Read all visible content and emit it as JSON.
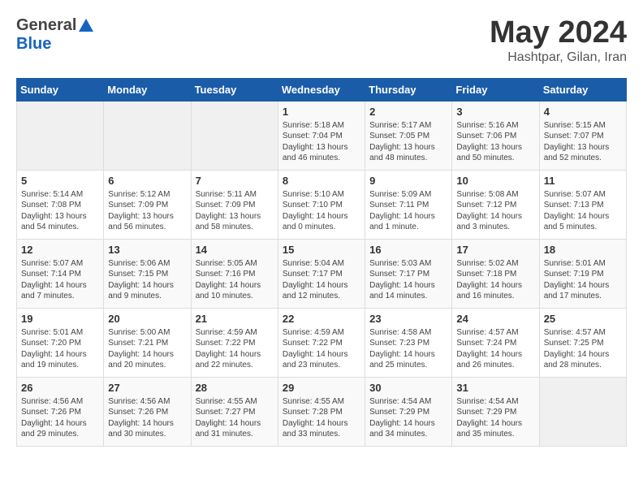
{
  "header": {
    "logo_general": "General",
    "logo_blue": "Blue",
    "month_title": "May 2024",
    "subtitle": "Hashtpar, Gilan, Iran"
  },
  "weekdays": [
    "Sunday",
    "Monday",
    "Tuesday",
    "Wednesday",
    "Thursday",
    "Friday",
    "Saturday"
  ],
  "weeks": [
    [
      {
        "day": "",
        "sunrise": "",
        "sunset": "",
        "daylight": ""
      },
      {
        "day": "",
        "sunrise": "",
        "sunset": "",
        "daylight": ""
      },
      {
        "day": "",
        "sunrise": "",
        "sunset": "",
        "daylight": ""
      },
      {
        "day": "1",
        "sunrise": "Sunrise: 5:18 AM",
        "sunset": "Sunset: 7:04 PM",
        "daylight": "Daylight: 13 hours and 46 minutes."
      },
      {
        "day": "2",
        "sunrise": "Sunrise: 5:17 AM",
        "sunset": "Sunset: 7:05 PM",
        "daylight": "Daylight: 13 hours and 48 minutes."
      },
      {
        "day": "3",
        "sunrise": "Sunrise: 5:16 AM",
        "sunset": "Sunset: 7:06 PM",
        "daylight": "Daylight: 13 hours and 50 minutes."
      },
      {
        "day": "4",
        "sunrise": "Sunrise: 5:15 AM",
        "sunset": "Sunset: 7:07 PM",
        "daylight": "Daylight: 13 hours and 52 minutes."
      }
    ],
    [
      {
        "day": "5",
        "sunrise": "Sunrise: 5:14 AM",
        "sunset": "Sunset: 7:08 PM",
        "daylight": "Daylight: 13 hours and 54 minutes."
      },
      {
        "day": "6",
        "sunrise": "Sunrise: 5:12 AM",
        "sunset": "Sunset: 7:09 PM",
        "daylight": "Daylight: 13 hours and 56 minutes."
      },
      {
        "day": "7",
        "sunrise": "Sunrise: 5:11 AM",
        "sunset": "Sunset: 7:09 PM",
        "daylight": "Daylight: 13 hours and 58 minutes."
      },
      {
        "day": "8",
        "sunrise": "Sunrise: 5:10 AM",
        "sunset": "Sunset: 7:10 PM",
        "daylight": "Daylight: 14 hours and 0 minutes."
      },
      {
        "day": "9",
        "sunrise": "Sunrise: 5:09 AM",
        "sunset": "Sunset: 7:11 PM",
        "daylight": "Daylight: 14 hours and 1 minute."
      },
      {
        "day": "10",
        "sunrise": "Sunrise: 5:08 AM",
        "sunset": "Sunset: 7:12 PM",
        "daylight": "Daylight: 14 hours and 3 minutes."
      },
      {
        "day": "11",
        "sunrise": "Sunrise: 5:07 AM",
        "sunset": "Sunset: 7:13 PM",
        "daylight": "Daylight: 14 hours and 5 minutes."
      }
    ],
    [
      {
        "day": "12",
        "sunrise": "Sunrise: 5:07 AM",
        "sunset": "Sunset: 7:14 PM",
        "daylight": "Daylight: 14 hours and 7 minutes."
      },
      {
        "day": "13",
        "sunrise": "Sunrise: 5:06 AM",
        "sunset": "Sunset: 7:15 PM",
        "daylight": "Daylight: 14 hours and 9 minutes."
      },
      {
        "day": "14",
        "sunrise": "Sunrise: 5:05 AM",
        "sunset": "Sunset: 7:16 PM",
        "daylight": "Daylight: 14 hours and 10 minutes."
      },
      {
        "day": "15",
        "sunrise": "Sunrise: 5:04 AM",
        "sunset": "Sunset: 7:17 PM",
        "daylight": "Daylight: 14 hours and 12 minutes."
      },
      {
        "day": "16",
        "sunrise": "Sunrise: 5:03 AM",
        "sunset": "Sunset: 7:17 PM",
        "daylight": "Daylight: 14 hours and 14 minutes."
      },
      {
        "day": "17",
        "sunrise": "Sunrise: 5:02 AM",
        "sunset": "Sunset: 7:18 PM",
        "daylight": "Daylight: 14 hours and 16 minutes."
      },
      {
        "day": "18",
        "sunrise": "Sunrise: 5:01 AM",
        "sunset": "Sunset: 7:19 PM",
        "daylight": "Daylight: 14 hours and 17 minutes."
      }
    ],
    [
      {
        "day": "19",
        "sunrise": "Sunrise: 5:01 AM",
        "sunset": "Sunset: 7:20 PM",
        "daylight": "Daylight: 14 hours and 19 minutes."
      },
      {
        "day": "20",
        "sunrise": "Sunrise: 5:00 AM",
        "sunset": "Sunset: 7:21 PM",
        "daylight": "Daylight: 14 hours and 20 minutes."
      },
      {
        "day": "21",
        "sunrise": "Sunrise: 4:59 AM",
        "sunset": "Sunset: 7:22 PM",
        "daylight": "Daylight: 14 hours and 22 minutes."
      },
      {
        "day": "22",
        "sunrise": "Sunrise: 4:59 AM",
        "sunset": "Sunset: 7:22 PM",
        "daylight": "Daylight: 14 hours and 23 minutes."
      },
      {
        "day": "23",
        "sunrise": "Sunrise: 4:58 AM",
        "sunset": "Sunset: 7:23 PM",
        "daylight": "Daylight: 14 hours and 25 minutes."
      },
      {
        "day": "24",
        "sunrise": "Sunrise: 4:57 AM",
        "sunset": "Sunset: 7:24 PM",
        "daylight": "Daylight: 14 hours and 26 minutes."
      },
      {
        "day": "25",
        "sunrise": "Sunrise: 4:57 AM",
        "sunset": "Sunset: 7:25 PM",
        "daylight": "Daylight: 14 hours and 28 minutes."
      }
    ],
    [
      {
        "day": "26",
        "sunrise": "Sunrise: 4:56 AM",
        "sunset": "Sunset: 7:26 PM",
        "daylight": "Daylight: 14 hours and 29 minutes."
      },
      {
        "day": "27",
        "sunrise": "Sunrise: 4:56 AM",
        "sunset": "Sunset: 7:26 PM",
        "daylight": "Daylight: 14 hours and 30 minutes."
      },
      {
        "day": "28",
        "sunrise": "Sunrise: 4:55 AM",
        "sunset": "Sunset: 7:27 PM",
        "daylight": "Daylight: 14 hours and 31 minutes."
      },
      {
        "day": "29",
        "sunrise": "Sunrise: 4:55 AM",
        "sunset": "Sunset: 7:28 PM",
        "daylight": "Daylight: 14 hours and 33 minutes."
      },
      {
        "day": "30",
        "sunrise": "Sunrise: 4:54 AM",
        "sunset": "Sunset: 7:29 PM",
        "daylight": "Daylight: 14 hours and 34 minutes."
      },
      {
        "day": "31",
        "sunrise": "Sunrise: 4:54 AM",
        "sunset": "Sunset: 7:29 PM",
        "daylight": "Daylight: 14 hours and 35 minutes."
      },
      {
        "day": "",
        "sunrise": "",
        "sunset": "",
        "daylight": ""
      }
    ]
  ]
}
